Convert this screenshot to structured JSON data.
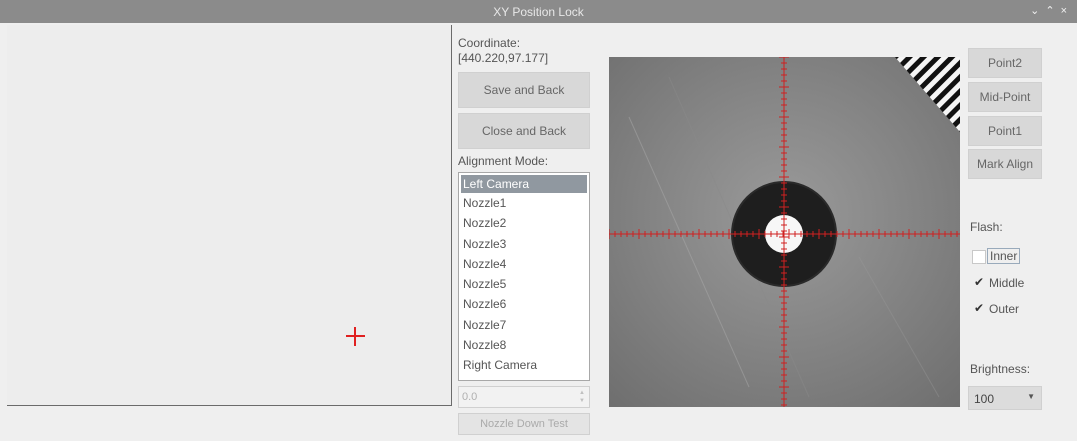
{
  "window": {
    "title": "XY Position Lock"
  },
  "coordinate": {
    "label": "Coordinate:",
    "value": "[440.220,97.177]"
  },
  "buttons": {
    "save_back": "Save and Back",
    "close_back": "Close and Back",
    "nozzle_down": "Nozzle Down Test",
    "point2": "Point2",
    "mid_point": "Mid-Point",
    "point1": "Point1",
    "mark_align": "Mark Align"
  },
  "alignment": {
    "label": "Alignment Mode:",
    "items": [
      "Left Camera",
      "Nozzle1",
      "Nozzle2",
      "Nozzle3",
      "Nozzle4",
      "Nozzle5",
      "Nozzle6",
      "Nozzle7",
      "Nozzle8",
      "Right Camera"
    ],
    "selected": "Left Camera"
  },
  "spin_value": "0.0",
  "flash": {
    "label": "Flash:",
    "inner": {
      "label": "Inner",
      "checked": false
    },
    "middle": {
      "label": "Middle",
      "checked": true
    },
    "outer": {
      "label": "Outer",
      "checked": true
    }
  },
  "brightness": {
    "label": "Brightness:",
    "value": "100"
  },
  "colors": {
    "titlebar": "#8b8b8b",
    "crosshair": "#e02020",
    "selection": "#9098a0"
  },
  "icons": {
    "window_controls": [
      "chevron-down-icon",
      "chevron-up-icon",
      "close-icon"
    ],
    "check": "check-icon"
  }
}
